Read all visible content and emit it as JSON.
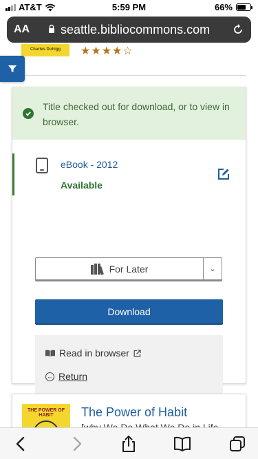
{
  "status_bar": {
    "carrier": "AT&T",
    "time": "5:59 PM",
    "battery": "66%",
    "battery_level": 0.66,
    "icons": [
      "cell-signal-icon",
      "wifi-icon",
      "battery-icon"
    ]
  },
  "browser": {
    "text_size_label": "AA",
    "domain": "seattle.bibliocommons.com",
    "icons": [
      "lock-icon",
      "reload-icon"
    ]
  },
  "top_item": {
    "cover_text": "Charles Duhigg",
    "stars": [
      "★",
      "★",
      "★",
      "★",
      "☆"
    ],
    "rating": 4
  },
  "filter": {
    "icon": "filter-icon"
  },
  "alert": {
    "message": "Title checked out for download, or to view in browser.",
    "color": "#e2f0de"
  },
  "format": {
    "label": "eBook - 2012",
    "status": "Available",
    "icons": [
      "tablet-icon",
      "edit-icon"
    ]
  },
  "for_later": {
    "label": "For Later",
    "caret": "⌄",
    "icon": "shelf-icon"
  },
  "download": {
    "label": "Download",
    "color": "#1e61a6"
  },
  "actions": {
    "read_label": "Read in browser",
    "return_label": "Return",
    "return_glyph": "←"
  },
  "next_item": {
    "cover_text": "THE POWER OF HABIT",
    "title": "The Power of Habit",
    "subtitle": "[why We Do What We Do in Life"
  },
  "toolbar": {
    "icons": [
      "back-arrow-icon",
      "forward-arrow-icon",
      "share-icon",
      "bookmarks-icon",
      "tabs-icon"
    ]
  }
}
